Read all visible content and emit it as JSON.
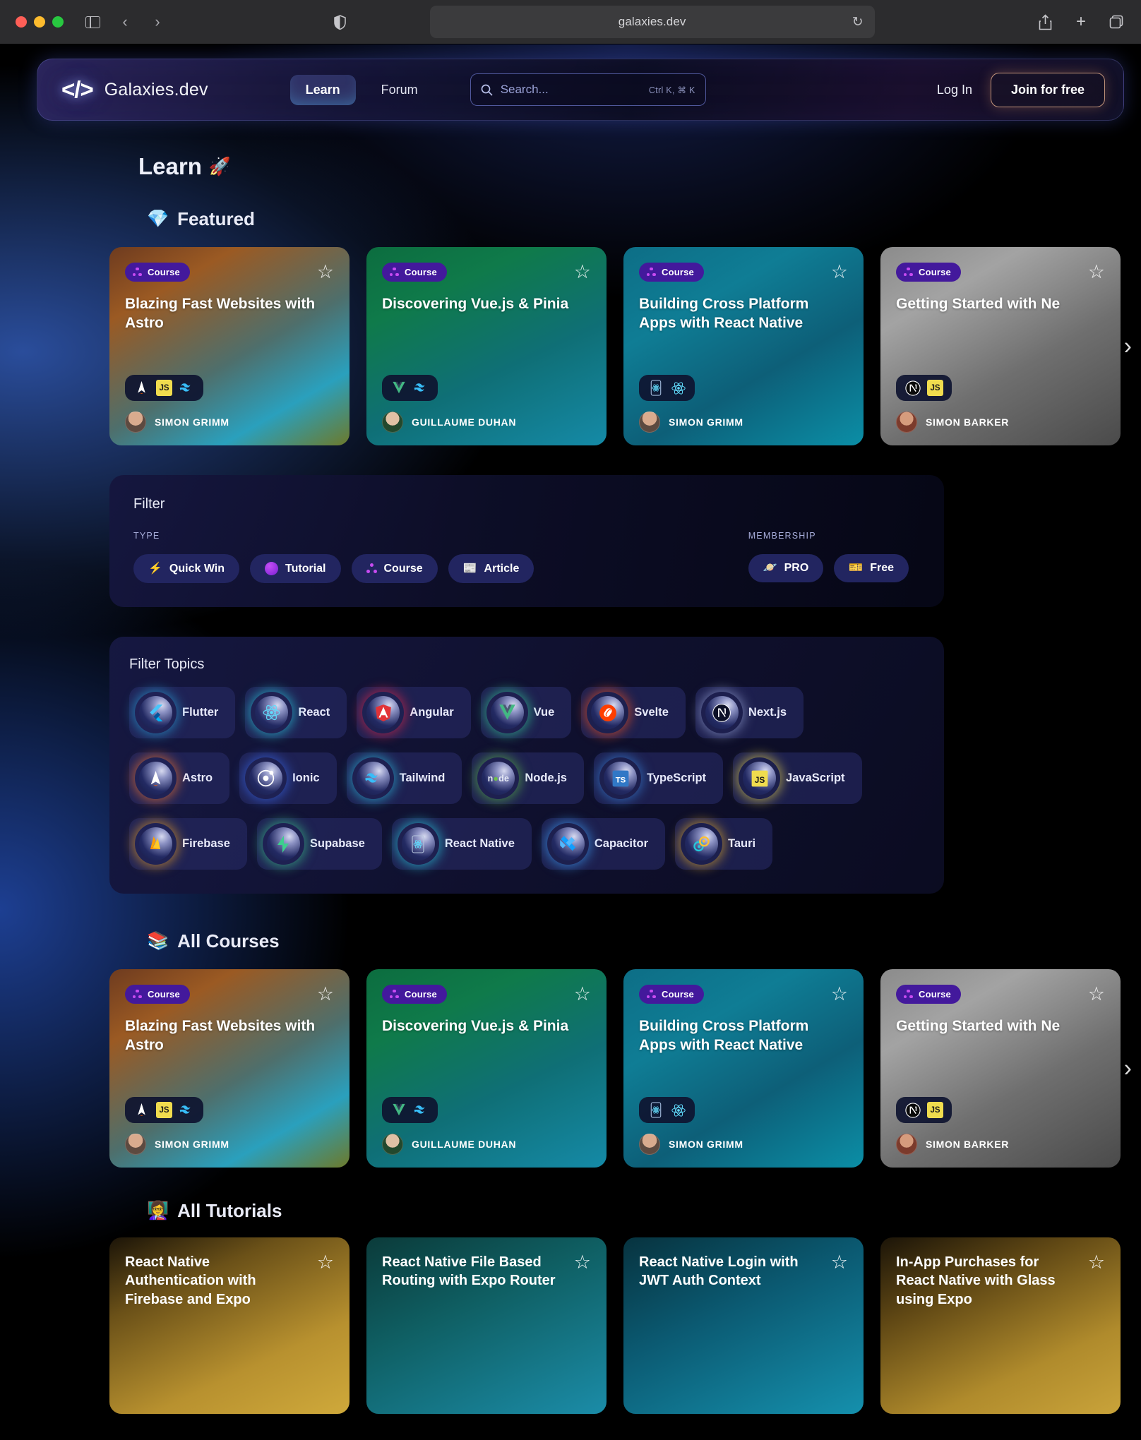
{
  "browser": {
    "url": "galaxies.dev",
    "reload_icon": "reload-icon",
    "share_icon": "share-icon",
    "new_tab_icon": "plus-icon",
    "tabs_icon": "tabs-icon",
    "sidebar_icon": "sidebar-icon",
    "back_icon": "back-arrow-icon",
    "forward_icon": "forward-arrow-icon",
    "shield_icon": "shield-icon"
  },
  "nav": {
    "brand_mark": "</>",
    "brand_name": "Galaxies.dev",
    "links": [
      {
        "label": "Learn",
        "active": true
      },
      {
        "label": "Forum",
        "active": false
      }
    ],
    "search": {
      "placeholder": "Search...",
      "shortcut": "Ctrl K, ⌘ K",
      "icon": "search-icon"
    },
    "login_label": "Log In",
    "join_label": "Join for free"
  },
  "page": {
    "title": "Learn",
    "title_emoji": "🚀"
  },
  "sections": {
    "featured": {
      "emoji": "💎",
      "title": "Featured"
    },
    "all_courses": {
      "emoji": "📚",
      "title": "All Courses"
    },
    "all_tutorials": {
      "emoji": "👩‍🏫",
      "title": "All Tutorials"
    }
  },
  "courses": [
    {
      "badge": "Course",
      "title": "Blazing Fast Websites with Astro",
      "author": "SIMON GRIMM",
      "stack": [
        "astro",
        "javascript",
        "tailwind"
      ],
      "theme": "astro"
    },
    {
      "badge": "Course",
      "title": "Discovering Vue.js & Pinia",
      "author": "GUILLAUME DUHAN",
      "stack": [
        "vue",
        "tailwind"
      ],
      "theme": "vue"
    },
    {
      "badge": "Course",
      "title": "Building Cross Platform Apps with React Native",
      "author": "SIMON GRIMM",
      "stack": [
        "react-native",
        "react"
      ],
      "theme": "rn"
    },
    {
      "badge": "Course",
      "title": "Getting Started with Ne",
      "author": "SIMON BARKER",
      "stack": [
        "nextjs",
        "javascript"
      ],
      "theme": "next"
    }
  ],
  "filter": {
    "title": "Filter",
    "type_label": "TYPE",
    "membership_label": "MEMBERSHIP",
    "types": [
      {
        "label": "Quick Win",
        "icon": "⚡"
      },
      {
        "label": "Tutorial",
        "icon": "tutorial-dot-icon"
      },
      {
        "label": "Course",
        "icon": "course-dots-icon"
      },
      {
        "label": "Article",
        "icon": "📰"
      }
    ],
    "memberships": [
      {
        "label": "PRO",
        "icon": "🪐"
      },
      {
        "label": "Free",
        "icon": "🎫"
      }
    ]
  },
  "topics": {
    "title": "Filter Topics",
    "rows": [
      [
        {
          "label": "Flutter",
          "glow": "#2aa9e0"
        },
        {
          "label": "React",
          "glow": "#2ad6e8"
        },
        {
          "label": "Angular",
          "glow": "#e8284a"
        },
        {
          "label": "Vue",
          "glow": "#36d399"
        },
        {
          "label": "Svelte",
          "glow": "#ff5722"
        },
        {
          "label": "Next.js",
          "glow": "#9aa6d8"
        }
      ],
      [
        {
          "label": "Astro",
          "glow": "#ff7a2f"
        },
        {
          "label": "Ionic",
          "glow": "#3b6bf0"
        },
        {
          "label": "Tailwind",
          "glow": "#2ec4e8"
        },
        {
          "label": "Node.js",
          "glow": "#5fbf4a"
        },
        {
          "label": "TypeScript",
          "glow": "#3b86e0"
        },
        {
          "label": "JavaScript",
          "glow": "#f0dc4e"
        }
      ],
      [
        {
          "label": "Firebase",
          "glow": "#f5a623"
        },
        {
          "label": "Supabase",
          "glow": "#3ecf8e"
        },
        {
          "label": "React Native",
          "glow": "#2ad6e8"
        },
        {
          "label": "Capacitor",
          "glow": "#3fa3ff"
        },
        {
          "label": "Tauri",
          "glow": "#f0b429"
        }
      ]
    ]
  },
  "tutorials": [
    {
      "title": "React Native Authentication with Firebase and Expo",
      "theme": "c1"
    },
    {
      "title": "React Native File Based Routing with Expo Router",
      "theme": "c2"
    },
    {
      "title": "React Native Login with JWT Auth Context",
      "theme": "c3"
    },
    {
      "title": "In-App Purchases for React Native with Glass using Expo",
      "theme": "c4"
    }
  ]
}
